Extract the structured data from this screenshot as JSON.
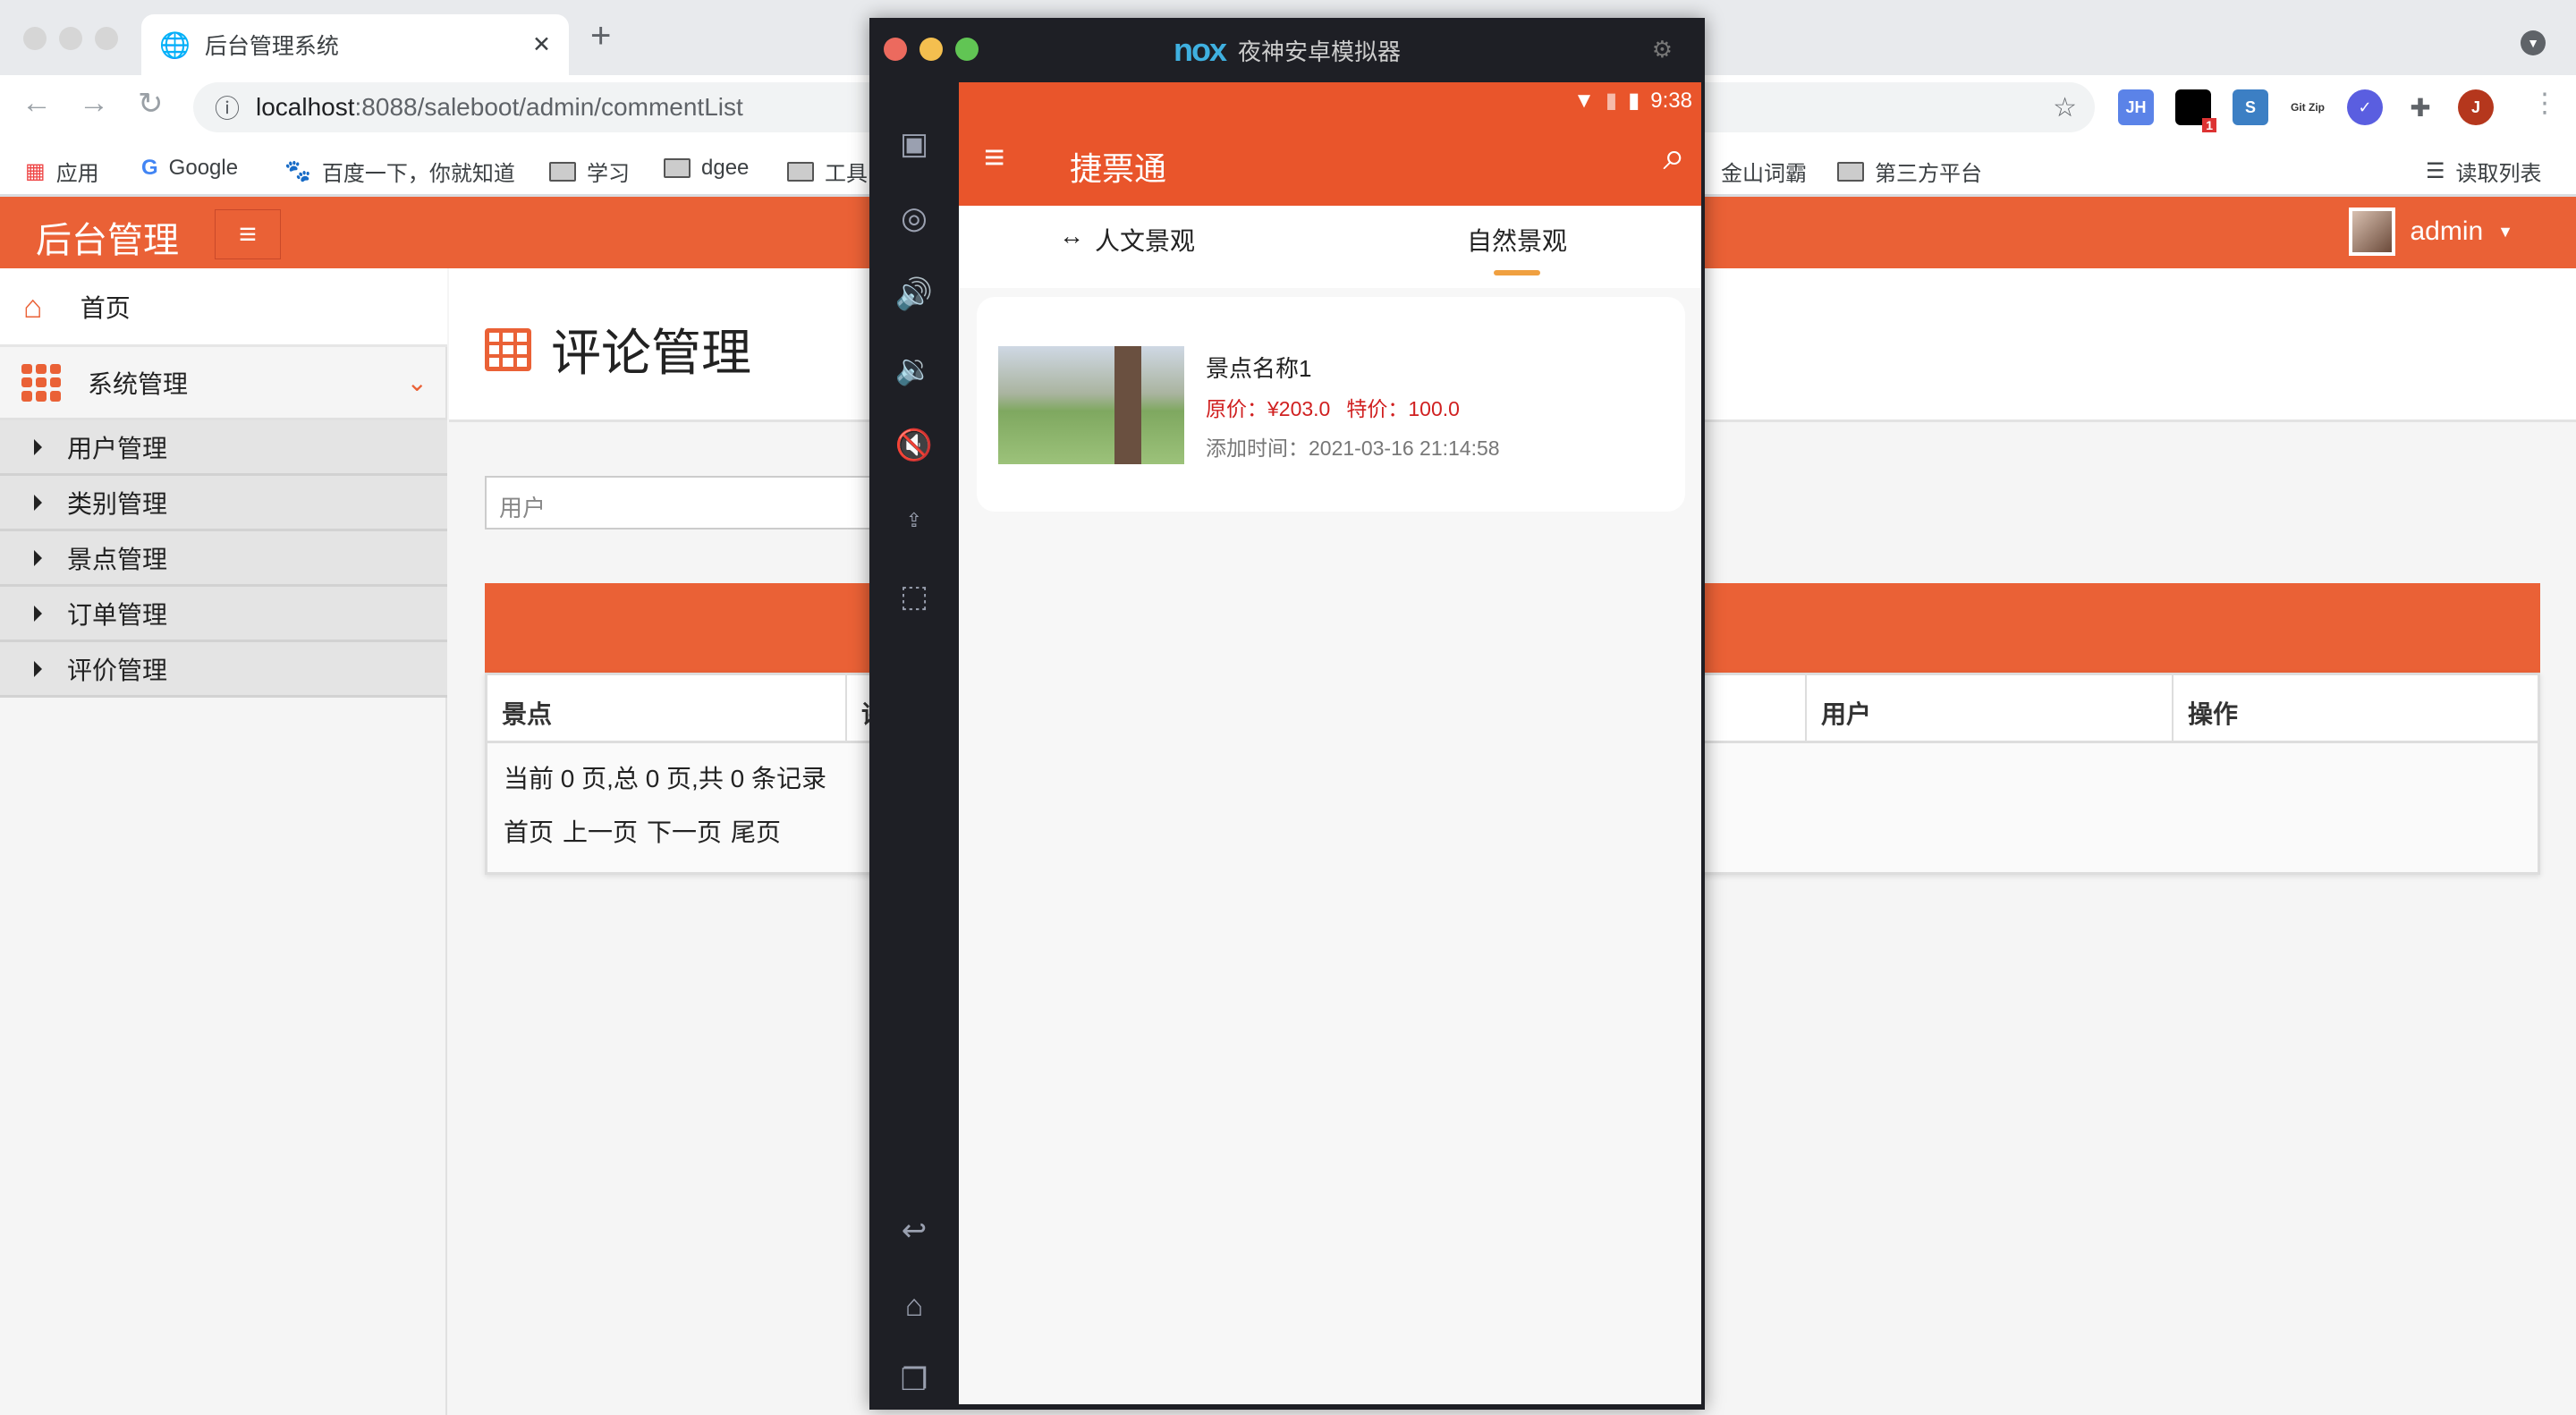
{
  "browser": {
    "tab_title": "后台管理系统",
    "url_host": "localhost",
    "url_rest": ":8088/saleboot/admin/commentList",
    "extensions": [
      "JH",
      "1",
      "S",
      "Git Zip",
      "J"
    ],
    "bookmarks": [
      "应用",
      "Google",
      "百度一下，你就知道",
      "学习",
      "dgee",
      "工具",
      "金山词霸",
      "第三方平台"
    ],
    "reading_list": "读取列表"
  },
  "app": {
    "brand": "后台管理",
    "user": "admin",
    "accent": "#ea6136",
    "sidebar": {
      "home": "首页",
      "group": "系统管理",
      "items": [
        "用户管理",
        "类别管理",
        "景点管理",
        "订单管理",
        "评价管理"
      ]
    },
    "page_title": "评论管理",
    "search_placeholder": "用户",
    "table": {
      "columns": [
        "景点",
        "评",
        "用户",
        "操作"
      ],
      "pagination_info": "当前 0 页,总 0 页,共 0 条记录",
      "pager": [
        "首页",
        "上一页",
        "下一页",
        "尾页"
      ]
    }
  },
  "emulator": {
    "logo": "nox",
    "title": "夜神安卓模拟器",
    "phone": {
      "time": "9:38",
      "app_title": "捷票通",
      "tabs": [
        "人文景观",
        "自然景观"
      ],
      "active_tab": 1,
      "items": [
        {
          "name": "景点名称1",
          "price": "原价：¥203.0",
          "special": "特价：100.0",
          "added": "添加时间：2021-03-16 21:14:58"
        }
      ]
    }
  }
}
